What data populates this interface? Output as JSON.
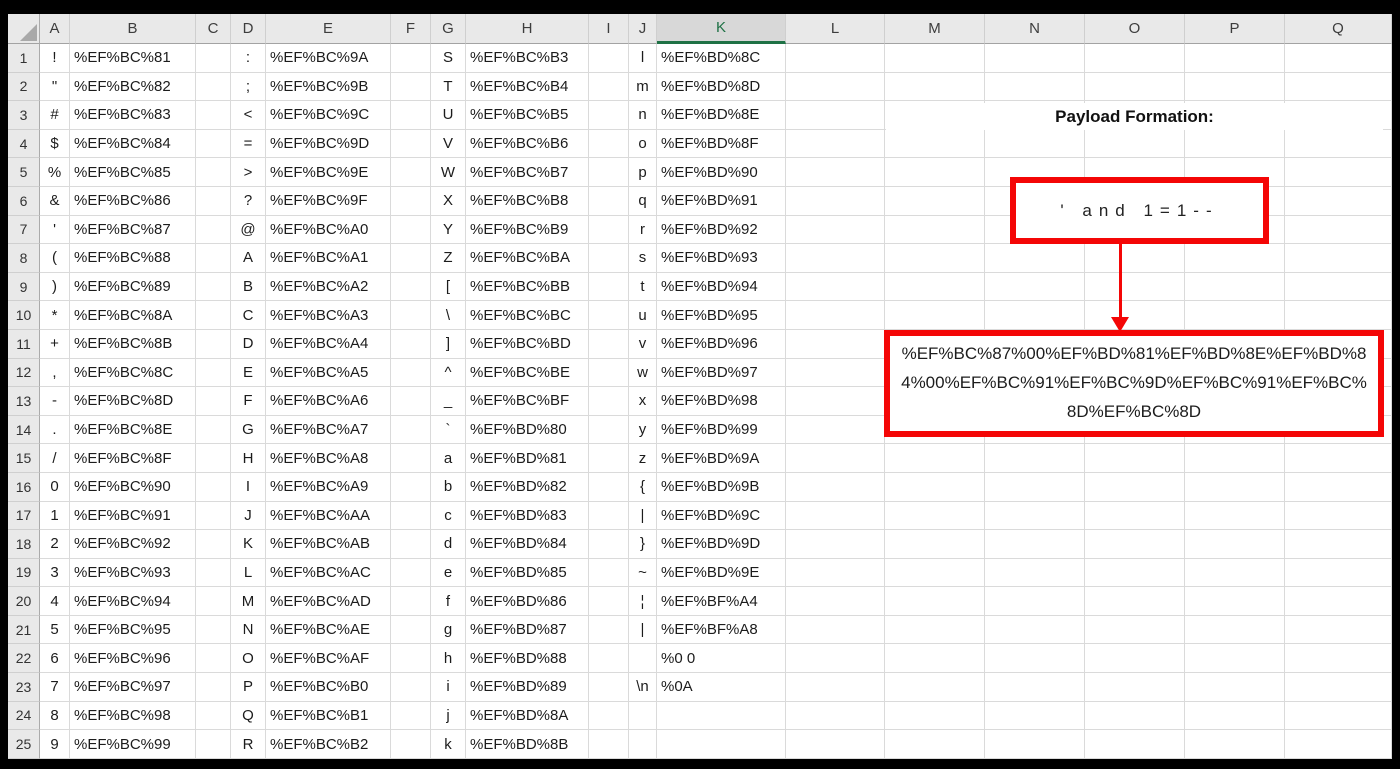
{
  "colors": {
    "annotation_accent": "#f40606",
    "selection_green": "#1e7145",
    "header_bg": "#e9e9e9",
    "selected_header_bg": "#d8d8d8"
  },
  "sheet": {
    "column_headers": [
      "A",
      "B",
      "C",
      "D",
      "E",
      "F",
      "G",
      "H",
      "I",
      "J",
      "K",
      "L",
      "M",
      "N",
      "O",
      "P",
      "Q"
    ],
    "selected_column": "K",
    "row_numbers": [
      1,
      2,
      3,
      4,
      5,
      6,
      7,
      8,
      9,
      10,
      11,
      12,
      13,
      14,
      15,
      16,
      17,
      18,
      19,
      20,
      21,
      22,
      23,
      24,
      25
    ],
    "pairs": [
      {
        "char_column": "A",
        "code_column": "B",
        "rows": [
          [
            "!",
            "%EF%BC%81"
          ],
          [
            "\"",
            "%EF%BC%82"
          ],
          [
            "#",
            "%EF%BC%83"
          ],
          [
            "$",
            "%EF%BC%84"
          ],
          [
            "%",
            "%EF%BC%85"
          ],
          [
            "&",
            "%EF%BC%86"
          ],
          [
            "'",
            "%EF%BC%87"
          ],
          [
            "(",
            "%EF%BC%88"
          ],
          [
            ")",
            "%EF%BC%89"
          ],
          [
            "*",
            "%EF%BC%8A"
          ],
          [
            "+",
            "%EF%BC%8B"
          ],
          [
            ",",
            "%EF%BC%8C"
          ],
          [
            "-",
            "%EF%BC%8D"
          ],
          [
            ".",
            "%EF%BC%8E"
          ],
          [
            "/",
            "%EF%BC%8F"
          ],
          [
            "0",
            "%EF%BC%90"
          ],
          [
            "1",
            "%EF%BC%91"
          ],
          [
            "2",
            "%EF%BC%92"
          ],
          [
            "3",
            "%EF%BC%93"
          ],
          [
            "4",
            "%EF%BC%94"
          ],
          [
            "5",
            "%EF%BC%95"
          ],
          [
            "6",
            "%EF%BC%96"
          ],
          [
            "7",
            "%EF%BC%97"
          ],
          [
            "8",
            "%EF%BC%98"
          ],
          [
            "9",
            "%EF%BC%99"
          ]
        ]
      },
      {
        "char_column": "D",
        "code_column": "E",
        "rows": [
          [
            ":",
            "%EF%BC%9A"
          ],
          [
            ";",
            "%EF%BC%9B"
          ],
          [
            "<",
            "%EF%BC%9C"
          ],
          [
            "=",
            "%EF%BC%9D"
          ],
          [
            ">",
            "%EF%BC%9E"
          ],
          [
            "?",
            "%EF%BC%9F"
          ],
          [
            "@",
            "%EF%BC%A0"
          ],
          [
            "A",
            "%EF%BC%A1"
          ],
          [
            "B",
            "%EF%BC%A2"
          ],
          [
            "C",
            "%EF%BC%A3"
          ],
          [
            "D",
            "%EF%BC%A4"
          ],
          [
            "E",
            "%EF%BC%A5"
          ],
          [
            "F",
            "%EF%BC%A6"
          ],
          [
            "G",
            "%EF%BC%A7"
          ],
          [
            "H",
            "%EF%BC%A8"
          ],
          [
            "I",
            "%EF%BC%A9"
          ],
          [
            "J",
            "%EF%BC%AA"
          ],
          [
            "K",
            "%EF%BC%AB"
          ],
          [
            "L",
            "%EF%BC%AC"
          ],
          [
            "M",
            "%EF%BC%AD"
          ],
          [
            "N",
            "%EF%BC%AE"
          ],
          [
            "O",
            "%EF%BC%AF"
          ],
          [
            "P",
            "%EF%BC%B0"
          ],
          [
            "Q",
            "%EF%BC%B1"
          ],
          [
            "R",
            "%EF%BC%B2"
          ]
        ]
      },
      {
        "char_column": "G",
        "code_column": "H",
        "rows": [
          [
            "S",
            "%EF%BC%B3"
          ],
          [
            "T",
            "%EF%BC%B4"
          ],
          [
            "U",
            "%EF%BC%B5"
          ],
          [
            "V",
            "%EF%BC%B6"
          ],
          [
            "W",
            "%EF%BC%B7"
          ],
          [
            "X",
            "%EF%BC%B8"
          ],
          [
            "Y",
            "%EF%BC%B9"
          ],
          [
            "Z",
            "%EF%BC%BA"
          ],
          [
            "[",
            "%EF%BC%BB"
          ],
          [
            "\\",
            "%EF%BC%BC"
          ],
          [
            "]",
            "%EF%BC%BD"
          ],
          [
            "^",
            "%EF%BC%BE"
          ],
          [
            "_",
            "%EF%BC%BF"
          ],
          [
            "`",
            "%EF%BD%80"
          ],
          [
            "a",
            "%EF%BD%81"
          ],
          [
            "b",
            "%EF%BD%82"
          ],
          [
            "c",
            "%EF%BD%83"
          ],
          [
            "d",
            "%EF%BD%84"
          ],
          [
            "e",
            "%EF%BD%85"
          ],
          [
            "f",
            "%EF%BD%86"
          ],
          [
            "g",
            "%EF%BD%87"
          ],
          [
            "h",
            "%EF%BD%88"
          ],
          [
            "i",
            "%EF%BD%89"
          ],
          [
            "j",
            "%EF%BD%8A"
          ],
          [
            "k",
            "%EF%BD%8B"
          ]
        ]
      },
      {
        "char_column": "J",
        "code_column": "K",
        "rows": [
          [
            "l",
            "%EF%BD%8C"
          ],
          [
            "m",
            "%EF%BD%8D"
          ],
          [
            "n",
            "%EF%BD%8E"
          ],
          [
            "o",
            "%EF%BD%8F"
          ],
          [
            "p",
            "%EF%BD%90"
          ],
          [
            "q",
            "%EF%BD%91"
          ],
          [
            "r",
            "%EF%BD%92"
          ],
          [
            "s",
            "%EF%BD%93"
          ],
          [
            "t",
            "%EF%BD%94"
          ],
          [
            "u",
            "%EF%BD%95"
          ],
          [
            "v",
            "%EF%BD%96"
          ],
          [
            "w",
            "%EF%BD%97"
          ],
          [
            "x",
            "%EF%BD%98"
          ],
          [
            "y",
            "%EF%BD%99"
          ],
          [
            "z",
            "%EF%BD%9A"
          ],
          [
            "{",
            "%EF%BD%9B"
          ],
          [
            "|",
            "%EF%BD%9C"
          ],
          [
            "}",
            "%EF%BD%9D"
          ],
          [
            "~",
            "%EF%BD%9E"
          ],
          [
            "¦",
            "%EF%BF%A4"
          ],
          [
            "|",
            "%EF%BF%A8"
          ],
          [
            "",
            "%0 0"
          ],
          [
            "\\n",
            "%0A"
          ]
        ]
      }
    ]
  },
  "annotation": {
    "title": "Payload Formation:",
    "payload_plain": "' and 1=1--",
    "payload_encoded_lines": [
      "%EF%BC%87%00%EF%BD%81%EF%BD%8E%EF%BD%8",
      "4%00%EF%BC%91%EF%BC%9D%EF%BC%91%EF%BC%",
      "8D%EF%BC%8D"
    ],
    "payload_encoded_full": "%EF%BC%87%00%EF%BD%81%EF%BD%8E%EF%BD%84%00%EF%BC%91%EF%BC%9D%EF%BC%91%EF%BC%8D%EF%BC%8D"
  }
}
